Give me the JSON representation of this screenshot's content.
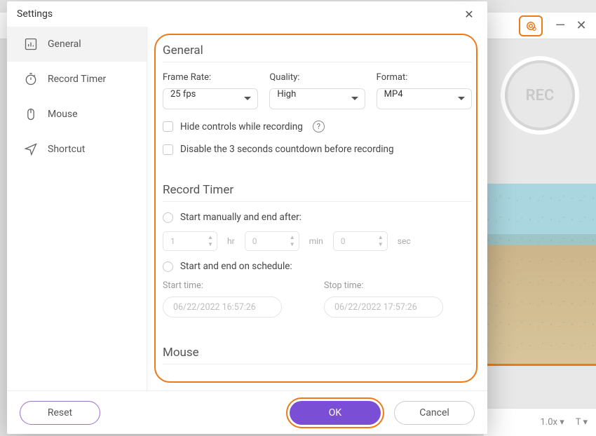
{
  "modal": {
    "title": "Settings",
    "close_glyph": "✕"
  },
  "sidebar": {
    "items": [
      {
        "label": "General"
      },
      {
        "label": "Record Timer"
      },
      {
        "label": "Mouse"
      },
      {
        "label": "Shortcut"
      }
    ]
  },
  "general": {
    "heading": "General",
    "frame_rate_label": "Frame Rate:",
    "frame_rate_value": "25 fps",
    "quality_label": "Quality:",
    "quality_value": "High",
    "format_label": "Format:",
    "format_value": "MP4",
    "hide_controls_label": "Hide controls while recording",
    "help_glyph": "?",
    "disable_countdown_label": "Disable the 3 seconds countdown before recording"
  },
  "timer": {
    "heading": "Record Timer",
    "manual_label": "Start manually and end after:",
    "hr_value": "1",
    "hr_unit": "hr",
    "min_value": "0",
    "min_unit": "min",
    "sec_value": "0",
    "sec_unit": "sec",
    "schedule_label": "Start and end on schedule:",
    "start_label": "Start time:",
    "start_value": "06/22/2022 16:57:26",
    "stop_label": "Stop time:",
    "stop_value": "06/22/2022 17:57:26"
  },
  "mouse": {
    "heading": "Mouse"
  },
  "footer": {
    "reset_label": "Reset",
    "ok_label": "OK",
    "cancel_label": "Cancel"
  },
  "bg": {
    "rec_label": "REC",
    "zoom_label": "1.0x"
  },
  "appbar": {
    "minimize_glyph": "—",
    "close_glyph": "✕"
  }
}
